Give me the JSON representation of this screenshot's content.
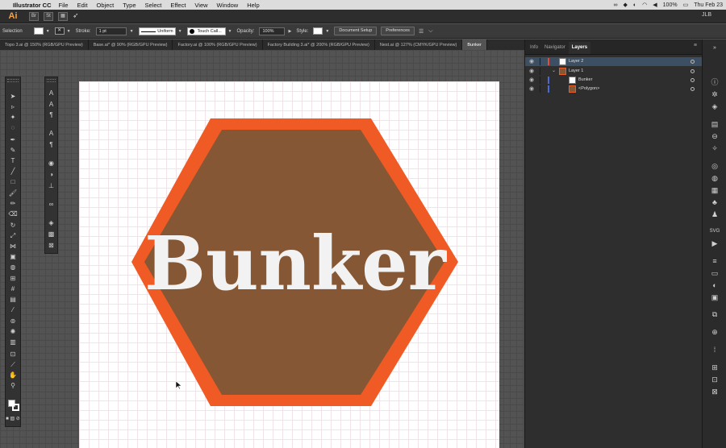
{
  "menubar": {
    "app_name": "Illustrator CC",
    "items": [
      "File",
      "Edit",
      "Object",
      "Type",
      "Select",
      "Effect",
      "View",
      "Window",
      "Help"
    ],
    "battery": "100%",
    "clock": "Thu Feb 23"
  },
  "appbar": {
    "logo": "Ai",
    "br_label": "Br",
    "st_label": "St",
    "user": "JLB"
  },
  "control_bar": {
    "selection_label": "Selection",
    "stroke_label": "Stroke:",
    "stroke_weight": "1 pt",
    "profile_label": "Uniform",
    "brush_label": "Touch Call...",
    "opacity_label": "Opacity:",
    "opacity_value": "100%",
    "style_label": "Style:",
    "document_setup": "Document Setup",
    "preferences": "Preferences"
  },
  "doc_tabs": [
    {
      "label": "Topo 3.ai @ 150% (RGB/GPU Preview)",
      "active": false
    },
    {
      "label": "Base.ai* @ 90% (RGB/GPU Preview)",
      "active": false
    },
    {
      "label": "Factory.ai @ 100% (RGB/GPU Preview)",
      "active": false
    },
    {
      "label": "Factory Building 3.ai* @ 200% (RGB/GPU Preview)",
      "active": false
    },
    {
      "label": "Nest.ai @ 127% (CMYK/GPU Preview)",
      "active": false
    },
    {
      "label": "Bunker",
      "active": true
    }
  ],
  "artwork": {
    "text": "Bunker",
    "hex_outer_color": "#f05a24",
    "hex_inner_color": "#855734",
    "text_color": "#f2f2f2"
  },
  "panel": {
    "tabs": [
      "Info",
      "Navigator",
      "Layers"
    ],
    "active_tab": "Layers",
    "layers": [
      {
        "name": "Layer 2",
        "selected": true,
        "indent": 0
      },
      {
        "name": "Layer 1",
        "selected": false,
        "indent": 0
      },
      {
        "name": "Bunker",
        "selected": false,
        "indent": 1
      },
      {
        "name": "<Polygon>",
        "selected": false,
        "indent": 1
      }
    ]
  },
  "colors": {
    "accent_layer2": "#e34b3b",
    "accent_layer1": "#4a6bd6"
  }
}
